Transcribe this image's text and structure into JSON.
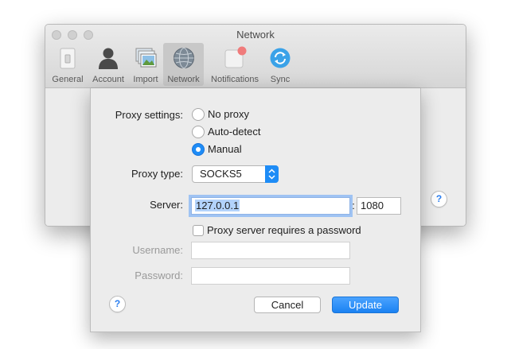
{
  "window": {
    "title": "Network"
  },
  "toolbar": {
    "items": [
      {
        "label": "General",
        "icon": "switch-icon"
      },
      {
        "label": "Account",
        "icon": "person-icon"
      },
      {
        "label": "Import",
        "icon": "photos-icon"
      },
      {
        "label": "Network",
        "icon": "globe-icon",
        "active": true
      },
      {
        "label": "Notifications",
        "icon": "notification-badge-icon"
      },
      {
        "label": "Sync",
        "icon": "sync-icon"
      }
    ]
  },
  "sheet": {
    "proxy_settings_label": "Proxy settings:",
    "proxy_options": [
      {
        "label": "No proxy",
        "checked": false
      },
      {
        "label": "Auto-detect",
        "checked": false
      },
      {
        "label": "Manual",
        "checked": true
      }
    ],
    "proxy_type_label": "Proxy type:",
    "proxy_type_value": "SOCKS5",
    "server_label": "Server:",
    "server_value": "127.0.0.1",
    "port_separator": ":",
    "port_value": "1080",
    "requires_password_label": "Proxy server requires a password",
    "requires_password_checked": false,
    "username_label": "Username:",
    "username_value": "",
    "password_label": "Password:",
    "password_value": "",
    "cancel_label": "Cancel",
    "update_label": "Update",
    "help_glyph": "?"
  },
  "colors": {
    "accent": "#1e8cf6",
    "selection": "#b3d3fb",
    "window_bg": "#ececec"
  }
}
